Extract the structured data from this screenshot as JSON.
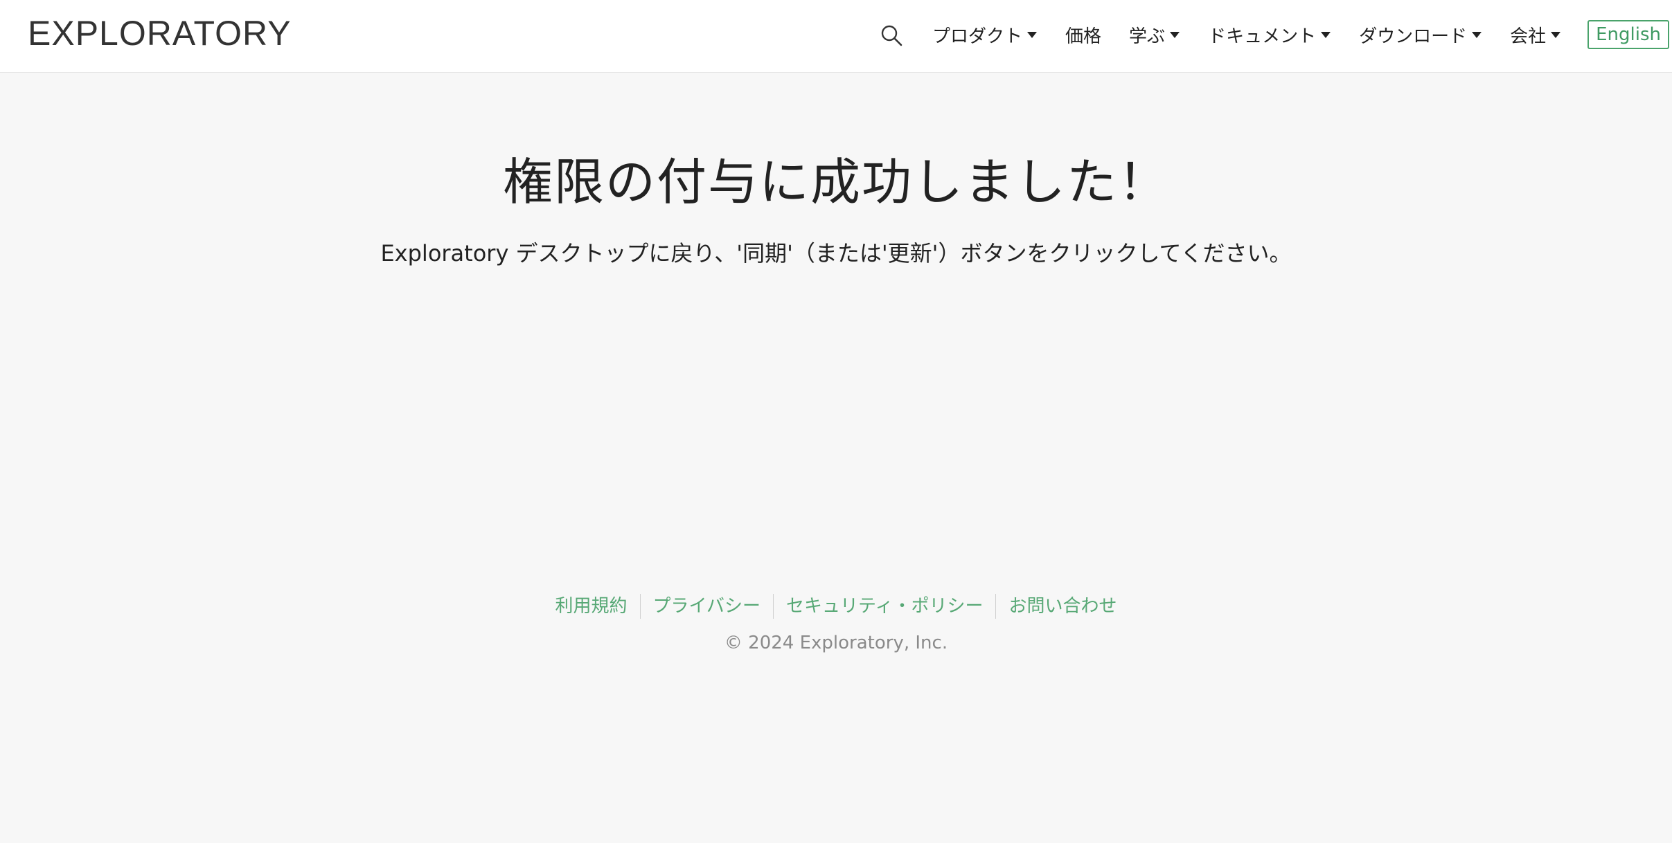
{
  "header": {
    "logo": "EXPLORATORY",
    "nav": [
      {
        "label": "プロダクト",
        "dropdown": true
      },
      {
        "label": "価格",
        "dropdown": false
      },
      {
        "label": "学ぶ",
        "dropdown": true
      },
      {
        "label": "ドキュメント",
        "dropdown": true
      },
      {
        "label": "ダウンロード",
        "dropdown": true
      },
      {
        "label": "会社",
        "dropdown": true
      }
    ],
    "language_button": "English",
    "icons": {
      "search": "search-icon",
      "caret": "caret-down-icon"
    }
  },
  "main": {
    "title": "権限の付与に成功しました！",
    "message": "Exploratory デスクトップに戻り、'同期'（または'更新'）ボタンをクリックしてください。"
  },
  "footer": {
    "links": [
      "利用規約",
      "プライバシー",
      "セキュリティ・ポリシー",
      "お問い合わせ"
    ],
    "copyright": "© 2024 Exploratory, Inc."
  },
  "colors": {
    "background": "#f7f7f7",
    "header_background": "#ffffff",
    "accent_green": "#4aa36b",
    "footer_link": "#57a875",
    "copyright_text": "#8a8a8a"
  }
}
